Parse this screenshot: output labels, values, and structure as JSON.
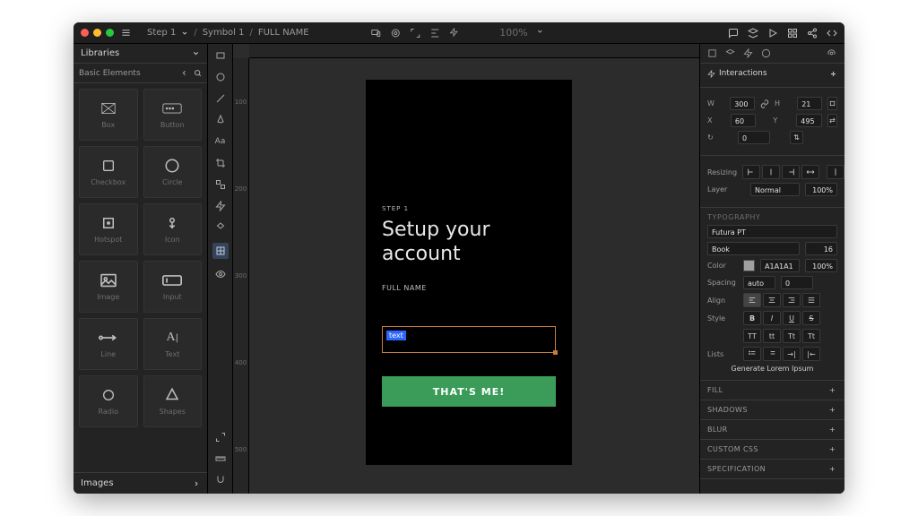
{
  "breadcrumb": {
    "item1": "Step 1",
    "item2": "Symbol 1",
    "item3": "FULL NAME"
  },
  "toolbar": {
    "zoom": "100%"
  },
  "left_panel": {
    "title": "Libraries",
    "category": "Basic Elements",
    "tiles": [
      {
        "label": "Box"
      },
      {
        "label": "Button"
      },
      {
        "label": "Checkbox"
      },
      {
        "label": "Circle"
      },
      {
        "label": "Hotspot"
      },
      {
        "label": "Icon"
      },
      {
        "label": "Image"
      },
      {
        "label": "Input"
      },
      {
        "label": "Line"
      },
      {
        "label": "Text"
      },
      {
        "label": "Radio"
      },
      {
        "label": "Shapes"
      }
    ],
    "bottom": "Images"
  },
  "ruler_v_marks": [
    "100",
    "200",
    "300",
    "400",
    "500"
  ],
  "artboard": {
    "step": "STEP 1",
    "title_line1": "Setup your",
    "title_line2": "account",
    "field_label": "FULL NAME",
    "input_placeholder": "text",
    "cta": "THAT'S ME!"
  },
  "right_panel": {
    "interactions": {
      "title": "Interactions"
    },
    "position": {
      "w_label": "W",
      "w": "300",
      "h_label": "H",
      "h": "21",
      "x_label": "X",
      "x": "60",
      "y_label": "Y",
      "y": "495",
      "rotate_label": "↻",
      "rotate": "0",
      "flip_label": "⇅"
    },
    "resizing": {
      "label": "Resizing"
    },
    "layer": {
      "label": "Layer",
      "mode": "Normal",
      "opacity": "100%"
    },
    "typography": {
      "headline": "TYPOGRAPHY",
      "font_family": "Futura PT",
      "font_weight": "Book",
      "font_size": "16",
      "color_label": "Color",
      "color_value": "A1A1A1",
      "color_opacity": "100%",
      "spacing_label": "Spacing",
      "spacing_mode": "auto",
      "spacing_value": "0",
      "align_label": "Align",
      "style_label": "Style",
      "lists_label": "Lists",
      "generate": "Generate Lorem Ipsum"
    },
    "collapsed": {
      "fill": "FILL",
      "shadows": "SHADOWS",
      "blur": "BLUR",
      "custom_css": "CUSTOM CSS",
      "specification": "SPECIFICATION"
    }
  }
}
